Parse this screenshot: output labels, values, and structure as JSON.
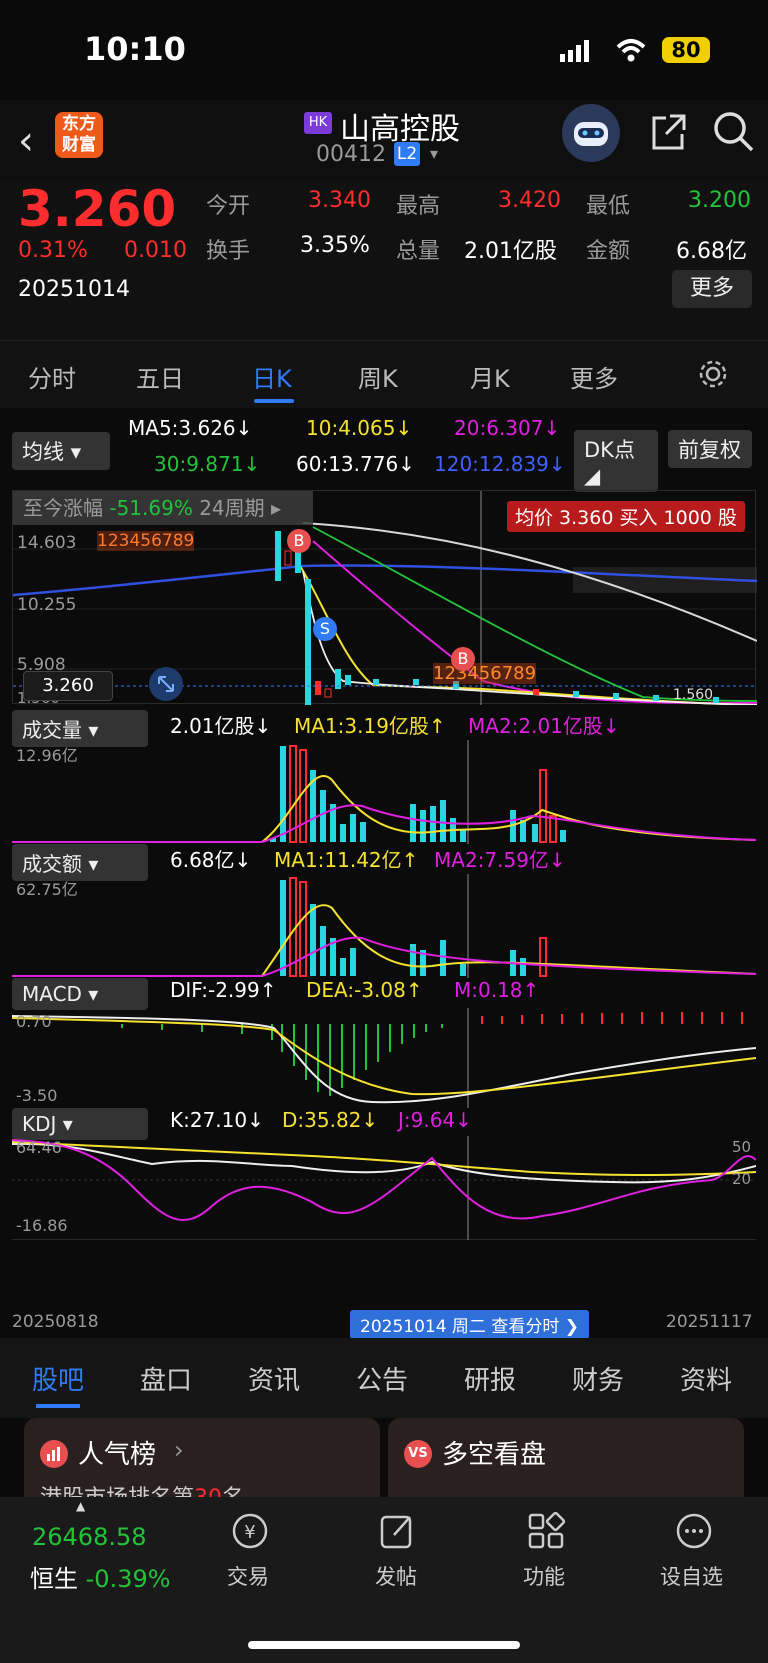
{
  "status": {
    "time": "10:10",
    "battery": "80"
  },
  "header": {
    "logo_line1": "东方",
    "logo_line2": "财富",
    "market_badge": "HK",
    "name": "山高控股",
    "code": "00412",
    "level": "L2"
  },
  "quote": {
    "price": "3.260",
    "pct": "0.31%",
    "chg": "0.010",
    "date": "20251014",
    "open_label": "今开",
    "open": "3.340",
    "high_label": "最高",
    "high": "3.420",
    "low_label": "最低",
    "low": "3.200",
    "turnover_rate_label": "换手",
    "turnover_rate": "3.35%",
    "volume_label": "总量",
    "volume": "2.01亿股",
    "amount_label": "金额",
    "amount": "6.68亿",
    "more": "更多"
  },
  "period_tabs": [
    "分时",
    "五日",
    "日K",
    "周K",
    "月K",
    "更多"
  ],
  "active_tab": "日K",
  "ma": {
    "selector": "均线",
    "ma5": "MA5:3.626↓",
    "ma10": "10:4.065↓",
    "ma20": "20:6.307↓",
    "ma30": "30:9.871↓",
    "ma60": "60:13.776↓",
    "ma120": "120:12.839↓",
    "dk": "DK点",
    "fq": "前复权"
  },
  "kline": {
    "range_label": "至今涨幅",
    "range_value": "-51.69%",
    "range_period": "24周期",
    "avg_notice": "均价 3.360 买入 1000 股",
    "y_high": "14.603",
    "y_mid": "10.255",
    "y_low": "5.908",
    "y_min": "1.560",
    "price_tag": "3.260",
    "right_tag": "1.560",
    "seq1": "123456789",
    "seq2": "123456789",
    "b_mark": "B",
    "s_mark": "S"
  },
  "volume": {
    "selector": "成交量",
    "value": "2.01亿股↓",
    "ma1": "MA1:3.19亿股↑",
    "ma2": "MA2:2.01亿股↓",
    "ymax": "12.96亿"
  },
  "amount": {
    "selector": "成交额",
    "value": "6.68亿↓",
    "ma1": "MA1:11.42亿↑",
    "ma2": "MA2:7.59亿↓",
    "ymax": "62.75亿"
  },
  "macd": {
    "selector": "MACD",
    "dif": "DIF:-2.99↑",
    "dea": "DEA:-3.08↑",
    "m": "M:0.18↑",
    "ytop": "0.70",
    "ybot": "-3.50"
  },
  "kdj": {
    "selector": "KDJ",
    "k": "K:27.10↓",
    "d": "D:35.82↓",
    "j": "J:9.64↓",
    "ytop": "64.46",
    "ybot": "-16.86",
    "lvl50": "50",
    "lvl20": "20"
  },
  "xaxis": {
    "start": "20250818",
    "end": "20251117",
    "cursor": "20251014 周二 查看分时 ❯"
  },
  "subtabs": [
    "股吧",
    "盘口",
    "资讯",
    "公告",
    "研报",
    "财务",
    "资料"
  ],
  "cards": {
    "left_title": "人气榜",
    "left_sub": "港股市场排名第",
    "left_rank": "30",
    "left_unit": "名",
    "right_title": "多空看盘"
  },
  "bottom": {
    "index_value": "26468.58",
    "index_name": "恒生",
    "index_pct": "-0.39%",
    "tabs": [
      "交易",
      "发帖",
      "功能",
      "设自选"
    ]
  },
  "colors": {
    "up": "#ff2d2d",
    "down": "#22c33a",
    "accent": "#2f7cf6",
    "ma_yellow": "#f5e130",
    "ma_magenta": "#e020e0",
    "ma_white": "#e8e8e8",
    "ma_blue": "#3050e0"
  },
  "chart_data": {
    "type": "candlestick",
    "x_start": "20250818",
    "x_end": "20251117",
    "price_axis": [
      1.56,
      5.908,
      10.255,
      14.603
    ]
  }
}
